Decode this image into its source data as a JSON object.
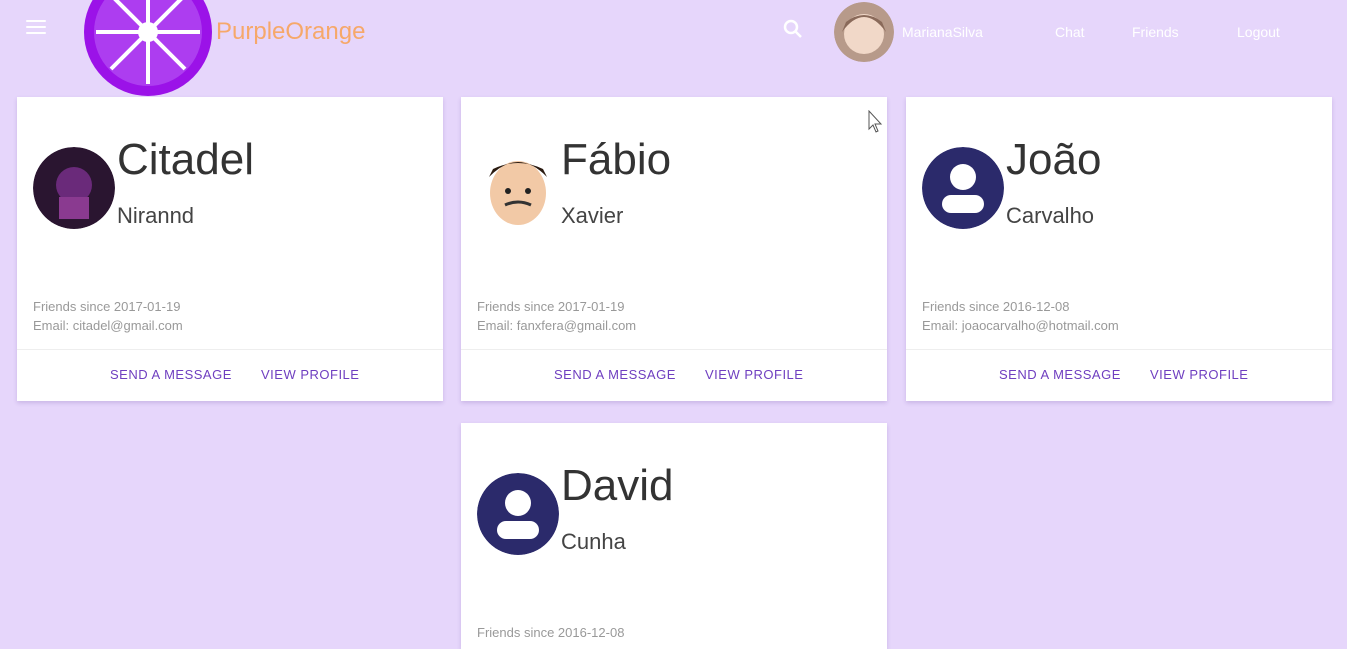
{
  "header": {
    "brand": "PurpleOrange",
    "user": "MarianaSilva",
    "links": [
      "Chat",
      "Friends",
      "Logout"
    ]
  },
  "friends": [
    {
      "first": "Citadel",
      "last": "Nirannd",
      "since": "Friends since 2017-01-19",
      "email": "Email: citadel@gmail.com",
      "avatar": "photo-avatar"
    },
    {
      "first": "Fábio",
      "last": "Xavier",
      "since": "Friends since 2017-01-19",
      "email": "Email: fanxfera@gmail.com",
      "avatar": "cartoon-avatar"
    },
    {
      "first": "João",
      "last": "Carvalho",
      "since": "Friends since 2016-12-08",
      "email": "Email: joaocarvalho@hotmail.com",
      "avatar": "default-avatar"
    },
    {
      "first": "David",
      "last": "Cunha",
      "since": "Friends since 2016-12-08",
      "email": "",
      "avatar": "default-avatar"
    }
  ],
  "actions": {
    "message": "SEND A MESSAGE",
    "profile": "VIEW PROFILE"
  },
  "colors": {
    "background": "#e6d6fb",
    "brand": "#f6a86a",
    "accent": "#6f3fc0",
    "avatar_default": "#2b2a6b",
    "logo": "#9b12e8"
  }
}
